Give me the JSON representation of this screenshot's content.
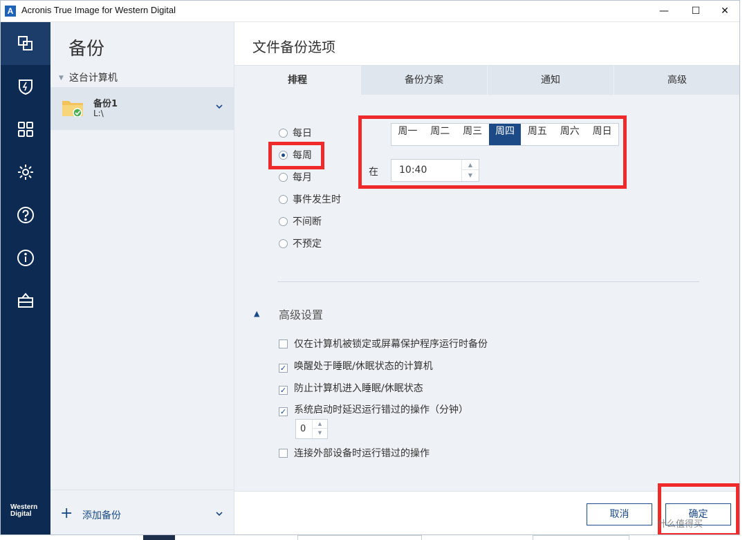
{
  "window": {
    "title": "Acronis True Image for Western Digital"
  },
  "sidebar": {
    "title": "备份",
    "tree_root": "这台计算机",
    "backup": {
      "name": "备份1",
      "path": "L:\\"
    },
    "add_label": "添加备份",
    "brand": "Western Digital"
  },
  "main": {
    "title": "文件备份选项",
    "tabs": [
      {
        "label": "排程"
      },
      {
        "label": "备份方案"
      },
      {
        "label": "通知"
      },
      {
        "label": "高级"
      }
    ],
    "schedule_options": [
      "每日",
      "每周",
      "每月",
      "事件发生时",
      "不间断",
      "不预定"
    ],
    "selected_option": "每周",
    "days": [
      "周一",
      "周二",
      "周三",
      "周四",
      "周五",
      "周六",
      "周日"
    ],
    "selected_day": "周四",
    "at_label": "在",
    "time": "10:40",
    "advanced_title": "高级设置",
    "advanced_options": [
      {
        "label": "仅在计算机被锁定或屏幕保护程序运行时备份",
        "checked": false
      },
      {
        "label": "唤醒处于睡眠/休眠状态的计算机",
        "checked": true
      },
      {
        "label": "防止计算机进入睡眠/休眠状态",
        "checked": true
      },
      {
        "label": "系统启动时延迟运行错过的操作（分钟）",
        "checked": true
      },
      {
        "label": "连接外部设备时运行错过的操作",
        "checked": false
      }
    ],
    "delay_minutes": "0",
    "cancel_label": "取消",
    "ok_label": "确定"
  },
  "watermark": "什么值得买",
  "colors": {
    "rail": "#0d2a52",
    "accent": "#1b4a87",
    "highlight": "#ee2a2a"
  }
}
